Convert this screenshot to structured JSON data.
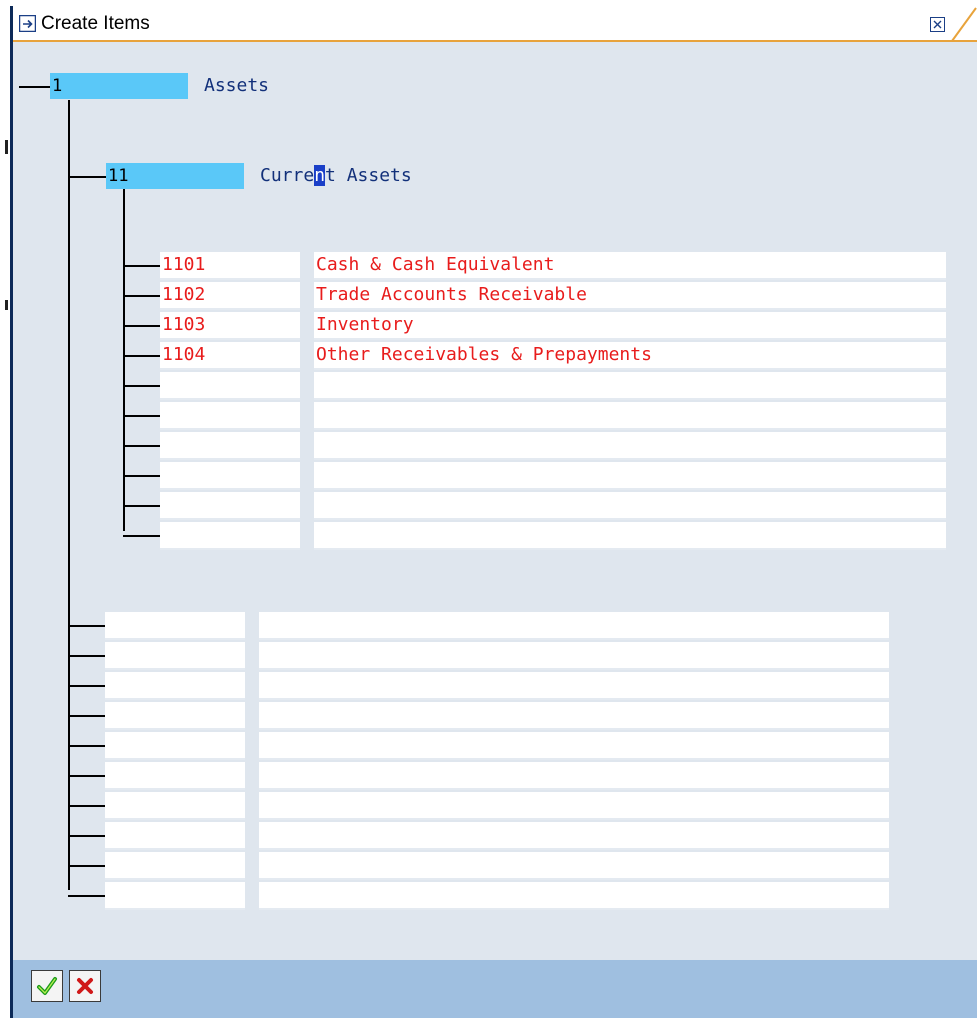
{
  "window": {
    "title": "Create Items"
  },
  "tree": {
    "root": {
      "id": "1",
      "label": "Assets"
    },
    "group": {
      "id": "11",
      "label_before_caret": "Curre",
      "label_caret": "n",
      "label_after_caret": "t Assets"
    },
    "items": [
      {
        "code": "1101",
        "description": "Cash & Cash Equivalent"
      },
      {
        "code": "1102",
        "description": "Trade Accounts Receivable"
      },
      {
        "code": "1103",
        "description": "Inventory"
      },
      {
        "code": "1104",
        "description": "Other Receivables & Prepayments"
      },
      {
        "code": "",
        "description": ""
      },
      {
        "code": "",
        "description": ""
      },
      {
        "code": "",
        "description": ""
      },
      {
        "code": "",
        "description": ""
      },
      {
        "code": "",
        "description": ""
      },
      {
        "code": "",
        "description": ""
      }
    ],
    "new_subgroup_rows": [
      {
        "code": "",
        "description": ""
      },
      {
        "code": "",
        "description": ""
      },
      {
        "code": "",
        "description": ""
      },
      {
        "code": "",
        "description": ""
      },
      {
        "code": "",
        "description": ""
      },
      {
        "code": "",
        "description": ""
      },
      {
        "code": "",
        "description": ""
      },
      {
        "code": "",
        "description": ""
      },
      {
        "code": "",
        "description": ""
      },
      {
        "code": "",
        "description": ""
      }
    ]
  },
  "footer": {
    "buttons": [
      {
        "name": "confirm",
        "icon": "checkmark-icon",
        "color": "#1a9a1a"
      },
      {
        "name": "cancel",
        "icon": "cancel-x-icon",
        "color": "#d01818"
      }
    ]
  },
  "colors": {
    "highlight_field": "#5ac8f8",
    "item_text": "#e81c1c",
    "node_label": "#12307a",
    "window_bg": "#dfe6ee",
    "footer_bg": "#9fbfe0",
    "title_underline": "#e8a33c"
  }
}
